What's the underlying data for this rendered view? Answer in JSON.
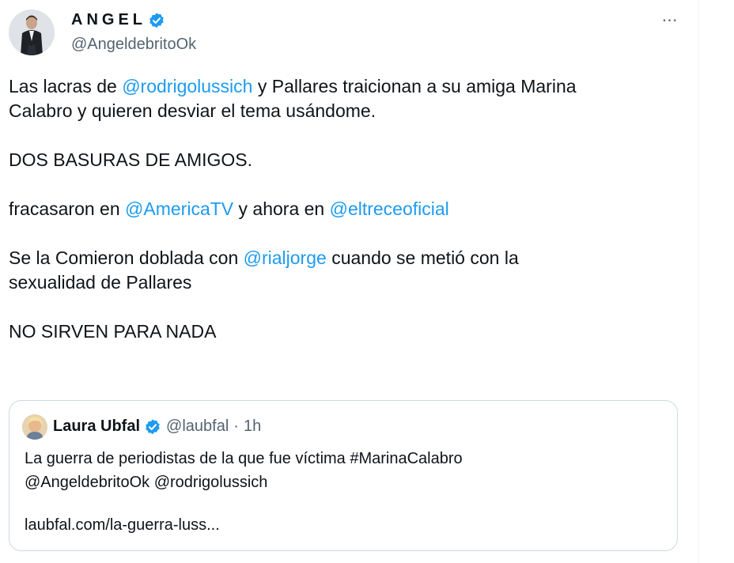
{
  "tweet": {
    "author_name": "ANGEL",
    "author_handle": "@AngeldebritoOk",
    "more_icon": "⋯",
    "paragraphs": {
      "p1": {
        "t1": "Las lacras de ",
        "m1": "@rodrigolussich",
        "t2": " y Pallares traicionan a su amiga Marina",
        "l2": "Calabro y quieren desviar el tema usándome."
      },
      "p2": "DOS BASURAS DE AMIGOS.",
      "p3": {
        "t1": "fracasaron en ",
        "m1": "@AmericaTV",
        "t2": " y ahora en ",
        "m2": "@eltreceoficial"
      },
      "p4": {
        "t1": "Se la Comieron doblada con ",
        "m1": "@rialjorge",
        "t2": " cuando se metió con la",
        "l2": "sexualidad de Pallares"
      },
      "p5": "NO SIRVEN PARA NADA"
    }
  },
  "quote": {
    "name": "Laura Ubfal",
    "handle": "@laubfal",
    "separator": "·",
    "time": "1h",
    "line1": "La guerra de periodistas de la que fue víctima #MarinaCalabro",
    "line2": "@AngeldebritoOk @rodrigolussich",
    "link": "laubfal.com/la-guerra-luss..."
  },
  "colors": {
    "link": "#1d9bf0",
    "verified": "#1d9bf0",
    "muted": "#536471",
    "border": "#cfd9de"
  }
}
